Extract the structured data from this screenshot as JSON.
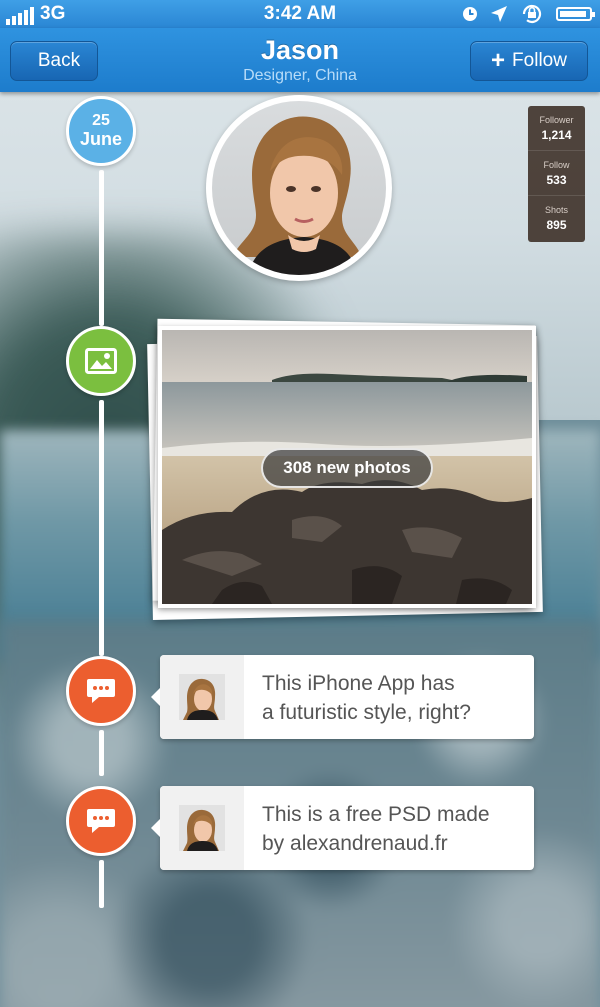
{
  "status_bar": {
    "carrier": "3G",
    "time": "3:42 AM"
  },
  "nav": {
    "back_label": "Back",
    "title": "Jason",
    "subtitle": "Designer, China",
    "follow_label": "Follow"
  },
  "timeline_date": {
    "day": "25",
    "month": "June"
  },
  "stats": [
    {
      "label": "Follower",
      "value": "1,214"
    },
    {
      "label": "Follow",
      "value": "533"
    },
    {
      "label": "Shots",
      "value": "895"
    }
  ],
  "photo_card": {
    "badge": "308 new photos"
  },
  "comments": [
    {
      "line1": "This iPhone App has",
      "line2": "a futuristic style, right?"
    },
    {
      "line1": "This is a free PSD made",
      "line2": "by alexandrenaud.fr"
    }
  ],
  "colors": {
    "nav_blue": "#1d7ccc",
    "date_dot": "#5bb1e6",
    "photo_dot": "#7bbf3f",
    "comment_dot": "#ec5e2f",
    "stats_bg": "#30201a"
  },
  "icons": [
    "signal-bars-icon",
    "clock-icon",
    "location-arrow-icon",
    "rotation-lock-icon",
    "battery-icon",
    "plus-icon",
    "picture-icon",
    "speech-bubble-icon"
  ]
}
